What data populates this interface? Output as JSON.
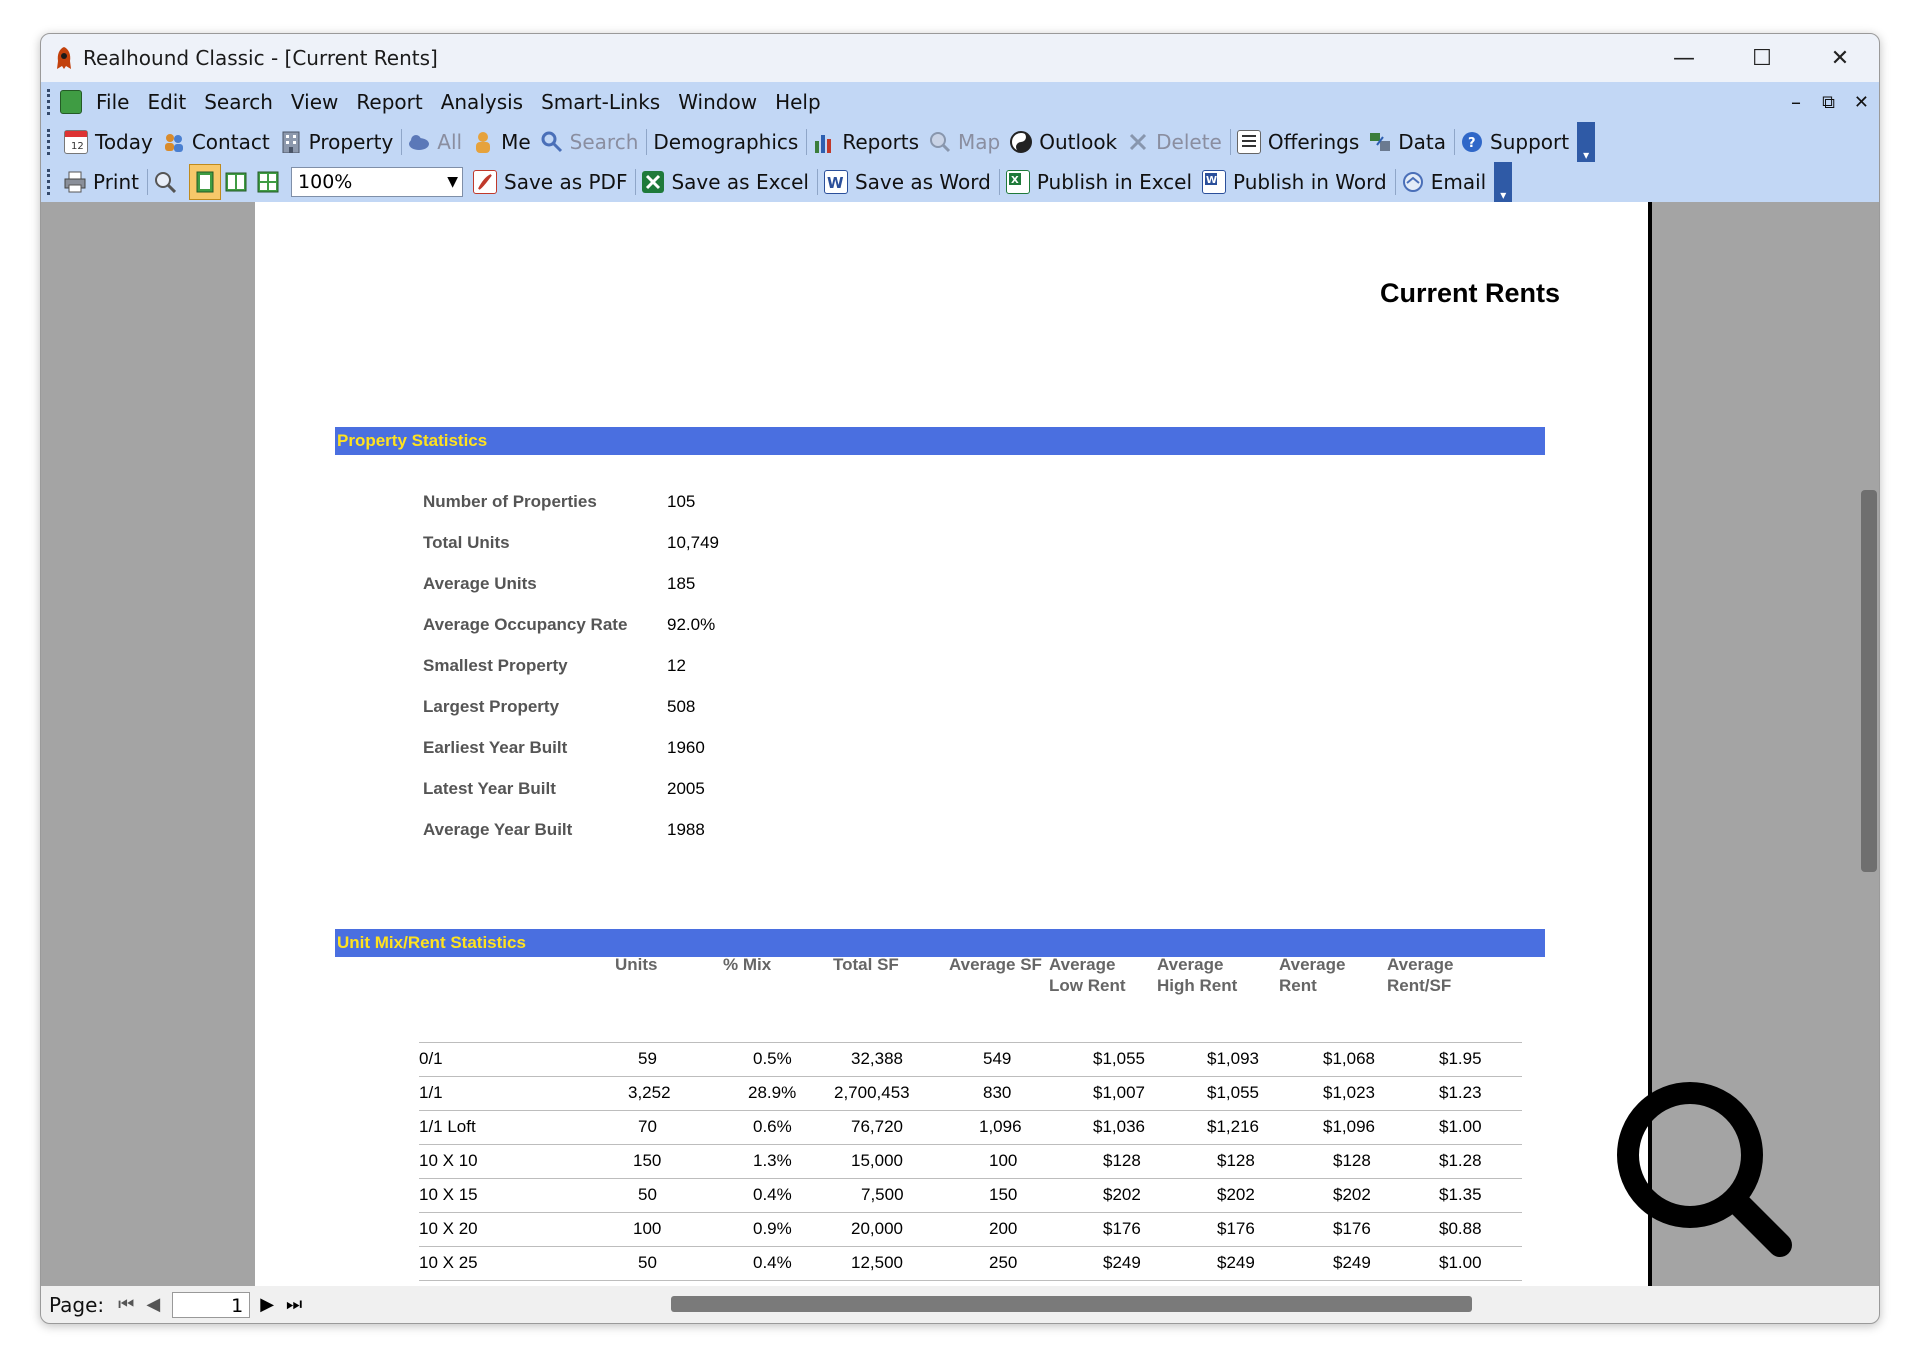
{
  "window": {
    "title": "Realhound Classic - [Current Rents]",
    "minimize": "—",
    "maximize": "☐",
    "close": "✕",
    "mdi_minimize": "–",
    "mdi_restore": "⧉",
    "mdi_close": "✕"
  },
  "menu": [
    "File",
    "Edit",
    "Search",
    "View",
    "Report",
    "Analysis",
    "Smart-Links",
    "Window",
    "Help"
  ],
  "toolbar1": {
    "today": "Today",
    "contact": "Contact",
    "property": "Property",
    "all": "All",
    "me": "Me",
    "search": "Search",
    "demographics": "Demographics",
    "reports": "Reports",
    "map": "Map",
    "outlook": "Outlook",
    "delete": "Delete",
    "offerings": "Offerings",
    "data": "Data",
    "support": "Support"
  },
  "toolbar2": {
    "print": "Print",
    "zoom": "100%",
    "save_pdf": "Save as PDF",
    "save_excel": "Save as Excel",
    "save_word": "Save as Word",
    "publish_excel": "Publish in Excel",
    "publish_word": "Publish in Word",
    "email": "Email"
  },
  "report": {
    "title": "Current Rents",
    "property_section": "Property Statistics",
    "stats": [
      {
        "label": "Number of Properties",
        "value": "105"
      },
      {
        "label": "Total Units",
        "value": "10,749"
      },
      {
        "label": "Average Units",
        "value": "185"
      },
      {
        "label": "Average Occupancy Rate",
        "value": "92.0%"
      },
      {
        "label": "Smallest Property",
        "value": "12"
      },
      {
        "label": "Largest Property",
        "value": "508"
      },
      {
        "label": "Earliest Year Built",
        "value": "1960"
      },
      {
        "label": "Latest Year Built",
        "value": "2005"
      },
      {
        "label": "Average Year Built",
        "value": "1988"
      }
    ],
    "unit_section": "Unit Mix/Rent Statistics",
    "columns": [
      {
        "line1": "Units",
        "line2": ""
      },
      {
        "line1": "% Mix",
        "line2": ""
      },
      {
        "line1": "Total SF",
        "line2": ""
      },
      {
        "line1": "Average SF",
        "line2": ""
      },
      {
        "line1": "Average",
        "line2": "Low Rent"
      },
      {
        "line1": "Average",
        "line2": "High Rent"
      },
      {
        "line1": "Average",
        "line2": "Rent"
      },
      {
        "line1": "Average",
        "line2": "Rent/SF"
      }
    ],
    "rows": [
      [
        "0/1",
        "59",
        "0.5%",
        "32,388",
        "549",
        "$1,055",
        "$1,093",
        "$1,068",
        "$1.95"
      ],
      [
        "1/1",
        "3,252",
        "28.9%",
        "2,700,453",
        "830",
        "$1,007",
        "$1,055",
        "$1,023",
        "$1.23"
      ],
      [
        "1/1 Loft",
        "70",
        "0.6%",
        "76,720",
        "1,096",
        "$1,036",
        "$1,216",
        "$1,096",
        "$1.00"
      ],
      [
        "10 X 10",
        "150",
        "1.3%",
        "15,000",
        "100",
        "$128",
        "$128",
        "$128",
        "$1.28"
      ],
      [
        "10 X 15",
        "50",
        "0.4%",
        "7,500",
        "150",
        "$202",
        "$202",
        "$202",
        "$1.35"
      ],
      [
        "10 X 20",
        "100",
        "0.9%",
        "20,000",
        "200",
        "$176",
        "$176",
        "$176",
        "$0.88"
      ],
      [
        "10 X 25",
        "50",
        "0.4%",
        "12,500",
        "250",
        "$249",
        "$249",
        "$249",
        "$1.00"
      ]
    ]
  },
  "status": {
    "page_label": "Page:",
    "page_number": "1"
  }
}
